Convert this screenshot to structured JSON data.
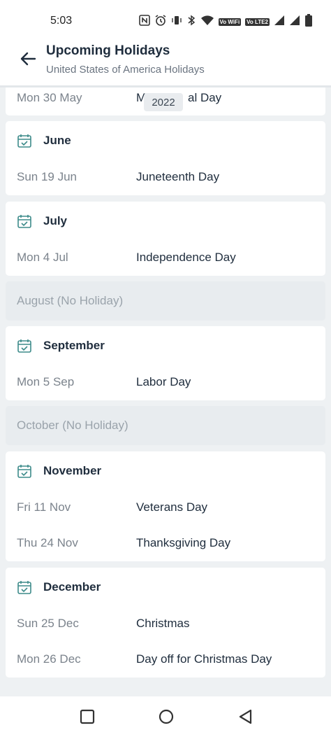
{
  "status_bar": {
    "time": "5:03",
    "icons": [
      "nfc-icon",
      "alarm-icon",
      "vibrate-icon",
      "bluetooth-icon",
      "wifi-icon",
      "vowifi-icon",
      "volte-icon",
      "signal-icon",
      "signal-icon",
      "battery-icon"
    ],
    "vowifi_label": "Vo WiFi",
    "volte_label": "Vo LTE2"
  },
  "header": {
    "title": "Upcoming Holidays",
    "subtitle": "United States of America Holidays"
  },
  "year_chip": "2022",
  "partial_card": {
    "date": "Mon 30 May",
    "name_left": "M",
    "name_right": "al Day"
  },
  "months": [
    {
      "label": "June",
      "holidays": [
        {
          "date": "Sun 19 Jun",
          "name": "Juneteenth Day"
        }
      ]
    },
    {
      "label": "July",
      "holidays": [
        {
          "date": "Mon 4 Jul",
          "name": "Independence Day"
        }
      ]
    },
    {
      "empty_label": "August (No Holiday)"
    },
    {
      "label": "September",
      "holidays": [
        {
          "date": "Mon 5 Sep",
          "name": "Labor Day"
        }
      ]
    },
    {
      "empty_label": "October (No Holiday)"
    },
    {
      "label": "November",
      "holidays": [
        {
          "date": "Fri 11 Nov",
          "name": "Veterans Day"
        },
        {
          "date": "Thu 24 Nov",
          "name": "Thanksgiving Day"
        }
      ]
    },
    {
      "label": "December",
      "holidays": [
        {
          "date": "Sun 25 Dec",
          "name": "Christmas"
        },
        {
          "date": "Mon 26 Dec",
          "name": "Day off for Christmas Day"
        }
      ]
    }
  ],
  "colors": {
    "accent_icon": "#3d8b8a",
    "background": "#eef1f3",
    "card": "#ffffff",
    "text_primary": "#1f2d3d",
    "text_secondary": "#7b838c"
  },
  "nav": [
    "recents-square-icon",
    "home-circle-icon",
    "back-triangle-icon"
  ]
}
